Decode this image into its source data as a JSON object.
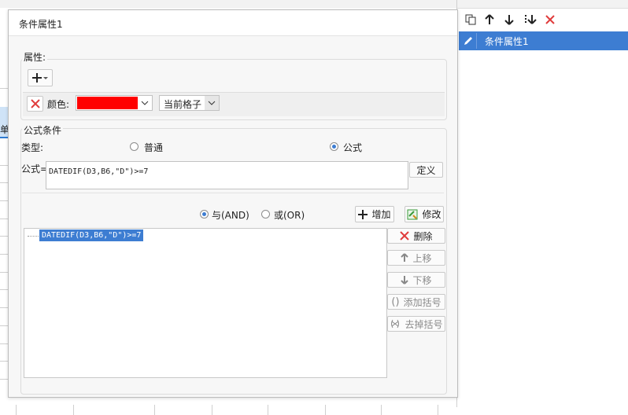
{
  "dialog": {
    "title": "条件属性1",
    "attributes": {
      "label": "属性:",
      "color_label": "颜色:",
      "color_value": "#ff0000",
      "scope_value": "当前格子"
    },
    "formula_condition": {
      "label": "公式条件",
      "type_label": "类型:",
      "type_options": [
        "普通",
        "公式"
      ],
      "selected_type": "公式",
      "formula_label": "公式=",
      "formula_value": "DATEDIF(D3,B6,\"D\")>=7",
      "define_button": "定义"
    },
    "logic": {
      "and_label": "与(AND)",
      "or_label": "或(OR)",
      "selected": "与(AND)",
      "add_button": "增加",
      "modify_button": "修改"
    },
    "condition_list": [
      "DATEDIF(D3,B6,\"D\")>=7"
    ],
    "side_buttons": {
      "delete": "删除",
      "move_up": "上移",
      "move_down": "下移",
      "add_bracket": "添加括号",
      "remove_bracket": "去掉括号"
    }
  },
  "right_panel": {
    "conditions": [
      "条件属性1"
    ]
  },
  "background": {
    "cell_text": "单"
  },
  "colors": {
    "accent": "#3d7dd2",
    "delete_red": "#e03c3c",
    "selection": "#3d7dd2"
  }
}
